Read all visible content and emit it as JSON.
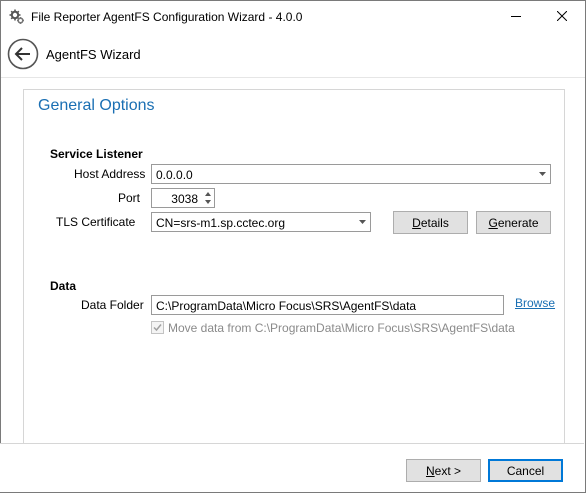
{
  "window": {
    "title": "File Reporter AgentFS Configuration Wizard - 4.0.0",
    "app_icon": "gears-icon"
  },
  "header": {
    "title": "AgentFS Wizard",
    "back_icon": "back-arrow-icon"
  },
  "page": {
    "title": "General Options"
  },
  "service_listener": {
    "section_label": "Service Listener",
    "host_address_label": "Host Address",
    "host_address_value": "0.0.0.0",
    "port_label": "Port",
    "port_value": "3038",
    "tls_label": "TLS Certificate",
    "tls_value": "CN=srs-m1.sp.cctec.org",
    "details_button_rest": "etails",
    "details_button_mnemonic": "D",
    "generate_button_rest": "enerate",
    "generate_button_mnemonic": "G"
  },
  "data_section": {
    "section_label": "Data",
    "data_folder_label": "Data Folder",
    "data_folder_value": "C:\\ProgramData\\Micro Focus\\SRS\\AgentFS\\data",
    "browse_link": "Browse",
    "move_data_label": "Move data from C:\\ProgramData\\Micro Focus\\SRS\\AgentFS\\data",
    "move_data_checked": true,
    "move_data_enabled": false
  },
  "footer": {
    "next_mnemonic": "N",
    "next_rest": "ext >",
    "cancel_label": "Cancel"
  },
  "colors": {
    "accent": "#1a6fb3",
    "focus_border": "#0078d7",
    "disabled_text": "#8a8a8a"
  }
}
